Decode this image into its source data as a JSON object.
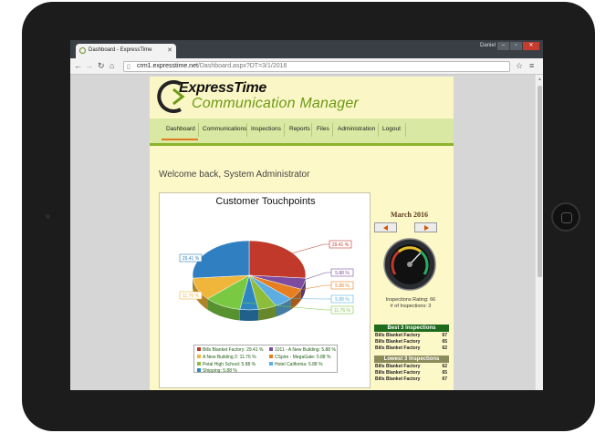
{
  "browser": {
    "tab_title": "Dashboard - ExpressTime",
    "user": "Daniel",
    "url_host": "crm1.expresstime.net",
    "url_path": "/Dashboard.aspx?DT=3/1/2016"
  },
  "app": {
    "logo_line1": "ExpressTime",
    "logo_line2": "Communication Manager",
    "menu": [
      "Dashboard",
      "Communications",
      "Inspections",
      "Reports",
      "Files",
      "Administration",
      "Logout"
    ],
    "welcome": "Welcome back, System Administrator"
  },
  "chart_data": {
    "type": "pie",
    "title": "Customer Touchpoints",
    "slices": [
      {
        "label": "Bills Blanket Factory",
        "value": 29.41,
        "display": "29.41 %",
        "color": "#c0392b"
      },
      {
        "label": "1011 - A New Building",
        "value": 5.88,
        "display": "5.88 %",
        "color": "#7d4c9e"
      },
      {
        "label": "CSpire - MegaGate",
        "value": 5.88,
        "display": "5.88 %",
        "color": "#e67e22"
      },
      {
        "label": "Hotel California",
        "value": 5.88,
        "display": "5.88 %",
        "color": "#5dade2"
      },
      {
        "label": "Petal High School",
        "value": 5.88,
        "display": "5.88 %",
        "color": "#8fbc3a"
      },
      {
        "label": "Shipping",
        "value": 5.88,
        "display": "5.88 %",
        "color": "#2e86c1"
      },
      {
        "label": "A New Building 2",
        "value": 11.76,
        "display": "11.76 %",
        "color": "#7ac943"
      },
      {
        "label": "A New Building 2",
        "value": 11.76,
        "display": "11.76 %",
        "color": "#f0b63c"
      },
      {
        "label": "Bills Blanket Factory",
        "value": 29.41,
        "display": "29.41 %",
        "color": "#2f7fc1"
      }
    ],
    "callouts": [
      "29.41 %",
      "5.88 %",
      "5.88 %",
      "5.88 %",
      "11.76 %",
      "11.76 %",
      "29.41 %"
    ],
    "legend": [
      {
        "label": "Bills Blanket Factory: 29.41 %",
        "color": "#c0392b"
      },
      {
        "label": "1011 - A New Building: 5.88 %",
        "color": "#7d4c9e"
      },
      {
        "label": "A New Building 2: 11.76 %",
        "color": "#f0b63c"
      },
      {
        "label": "CSpire - MegaGate: 5.88 %",
        "color": "#e67e22"
      },
      {
        "label": "Petal High School: 5.88 %",
        "color": "#8fbc3a"
      },
      {
        "label": "Hotel California: 5.88 %",
        "color": "#5dade2"
      },
      {
        "label": "Shipping: 5.88 %",
        "color": "#2e86c1"
      }
    ]
  },
  "side": {
    "month": "March 2016",
    "rating_line1": "Inspections Rating: 66",
    "rating_line2": "# of Inspections: 3",
    "rating_value": 66,
    "best_title": "Best 3 Inspections",
    "best": [
      {
        "name": "Bills Blanket Factory",
        "score": "67"
      },
      {
        "name": "Bills Blanket Factory",
        "score": "65"
      },
      {
        "name": "Bills Blanket Factory",
        "score": "62"
      }
    ],
    "lowest_title": "Lowest 3 Inspections",
    "lowest": [
      {
        "name": "Bills Blanket Factory",
        "score": "62"
      },
      {
        "name": "Bills Blanket Factory",
        "score": "65"
      },
      {
        "name": "Bills Blanket Factory",
        "score": "67"
      }
    ],
    "colors": {
      "best_header": "#1e6b1e",
      "lowest_header": "#8a8a5a"
    }
  }
}
